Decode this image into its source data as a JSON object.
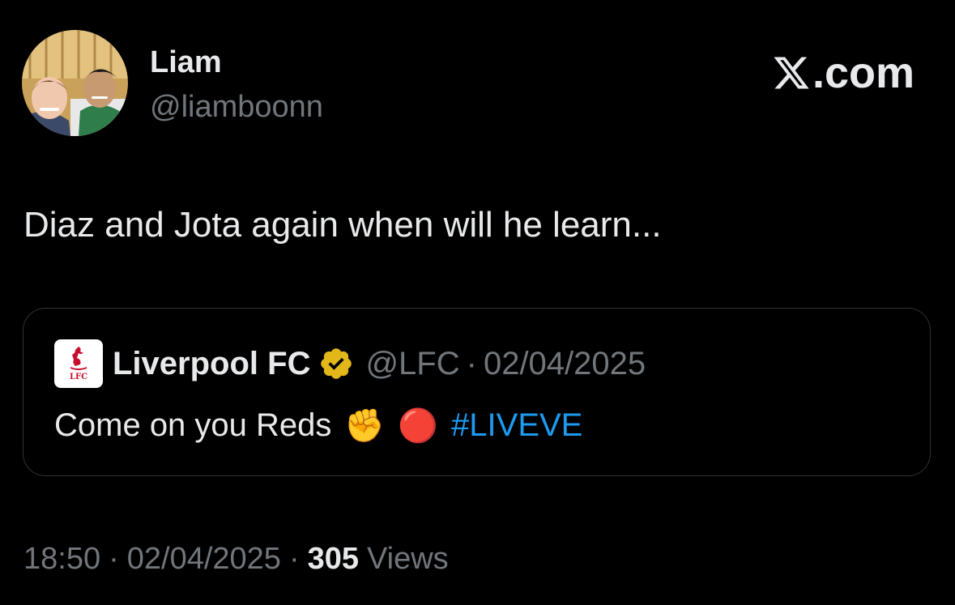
{
  "author": {
    "display_name": "Liam",
    "handle": "@liamboonn",
    "avatar": "profile-photo-avatar"
  },
  "brand": {
    "text": ".com",
    "icon": "x-logo-icon"
  },
  "tweet": {
    "text": "Diaz and Jota again when will he learn..."
  },
  "quote": {
    "logo_icon": "liverpool-fc-crest-icon",
    "name": "Liverpool FC",
    "verified_icon": "verified-badge-icon",
    "handle": "@LFC",
    "separator": "·",
    "date": "02/04/2025",
    "text": "Come on you Reds",
    "emoji_1": "✊",
    "emoji_2": "🔴",
    "hashtag": "#LIVEVE"
  },
  "meta": {
    "time": "18:50",
    "separator": "·",
    "date": "02/04/2025",
    "views_count": "305",
    "views_label": "Views"
  },
  "colors": {
    "background": "#000000",
    "text_primary": "#e7e9ea",
    "text_secondary": "#71767b",
    "link": "#1d9bf0",
    "border": "#2f3336",
    "verified_gold": "#e2b719",
    "lfc_red": "#c8102e"
  }
}
